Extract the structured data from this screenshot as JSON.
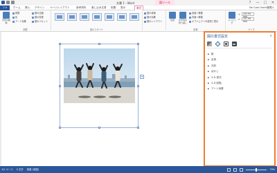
{
  "window": {
    "title": "文書 1 - Word",
    "context_header": "図ツール",
    "controls": {
      "help": "?",
      "minimize": "—",
      "restore": "▢",
      "close": "✕"
    }
  },
  "tabs": {
    "file": "ファイル",
    "items": [
      "ホーム",
      "挿入",
      "デザイン",
      "ページレイアウト",
      "参考資料",
      "差し込み文書",
      "校閲",
      "表示"
    ],
    "format": "書式",
    "user": "Be Cool Users管理人"
  },
  "ribbon": {
    "adjust": {
      "label": "調整",
      "remove_bg": "背景の削除",
      "corrections": "修整",
      "color": "色",
      "artistic": "アート効果",
      "compress": "図の圧縮",
      "change": "図の変更",
      "reset": "図のリセット"
    },
    "styles": {
      "label": "図のスタイル"
    },
    "picture_opts": {
      "border": "図の枠線",
      "effects": "図の効果",
      "layout": "図のレイアウト"
    },
    "arrange": {
      "label": "配置",
      "position": "位置",
      "wrap": "文字列の折り返し",
      "forward": "前面へ移動",
      "backward": "背面へ移動",
      "selection": "オブジェクトの選択と表示"
    },
    "size": {
      "label": "サイズ",
      "crop": "トリミング",
      "height": "102.94 mm",
      "width": "137.99 mm"
    }
  },
  "pane": {
    "title": "図の書式設定",
    "close": "✕",
    "sections": [
      "影",
      "反射",
      "光彩",
      "ぼかし",
      "3-D 書式",
      "3-D 回転",
      "アート効果"
    ]
  },
  "status": {
    "page": "1/1 ページ",
    "words": "0 文字",
    "language": "英語 (米国)",
    "zoom": "70%"
  },
  "colors": {
    "accent": "#2b579a",
    "context": "#c2185b",
    "pane_border": "#ec7c30"
  }
}
